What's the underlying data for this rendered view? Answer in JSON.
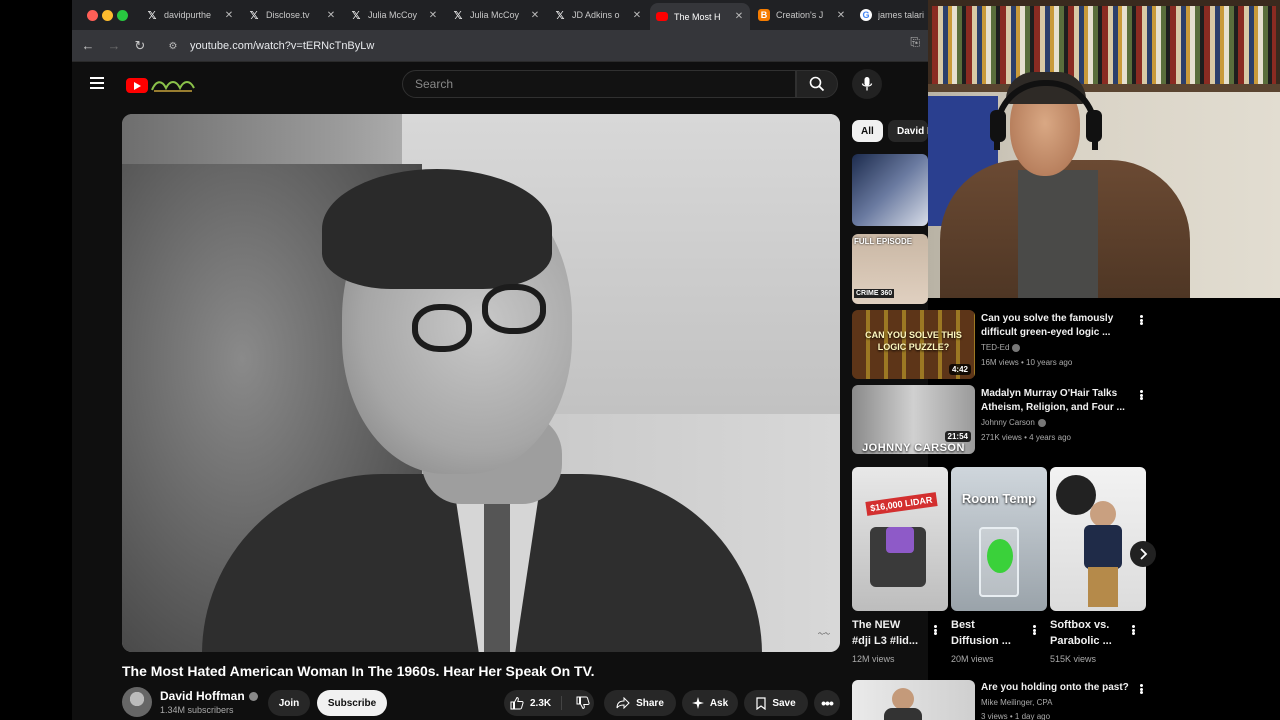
{
  "browser": {
    "tabs": [
      {
        "label": "davidpurthe",
        "icon": "x-icon",
        "active": false
      },
      {
        "label": "Disclose.tv",
        "icon": "x-icon",
        "active": false
      },
      {
        "label": "Julia McCoy",
        "icon": "x-icon",
        "active": false
      },
      {
        "label": "Julia McCoy",
        "icon": "x-icon",
        "active": false
      },
      {
        "label": "JD Adkins o",
        "icon": "x-icon",
        "active": false
      },
      {
        "label": "The Most H",
        "icon": "youtube-icon",
        "active": true
      },
      {
        "label": "Creation's J",
        "icon": "blogger-icon",
        "active": false
      },
      {
        "label": "james talari",
        "icon": "google-icon",
        "active": false
      }
    ],
    "url": "youtube.com/watch?v=tERNcTnByLw"
  },
  "header": {
    "search_placeholder": "Search"
  },
  "video": {
    "title": "The Most Hated American Woman In The 1960s. Hear Her Speak On TV.",
    "channel": "David Hoffman",
    "subscribers": "1.34M subscribers",
    "join_label": "Join",
    "subscribe_label": "Subscribe",
    "likes": "2.3K",
    "share_label": "Share",
    "ask_label": "Ask",
    "save_label": "Save"
  },
  "sidebar": {
    "chips": [
      "All",
      "David H"
    ],
    "videos": [
      {
        "title_line1": "Can you solve the famously",
        "title_line2": "difficult green-eyed logic ...",
        "channel": "TED-Ed",
        "meta": "16M views • 10 years ago",
        "duration": "4:42",
        "thumb_text_1": "CAN YOU SOLVE THIS",
        "thumb_text_2": "LOGIC PUZZLE?"
      },
      {
        "title_line1": "Madalyn Murray O'Hair Talks",
        "title_line2": "Atheism, Religion, and Four ...",
        "channel": "Johnny Carson",
        "meta": "271K views • 4 years ago",
        "duration": "21:54",
        "thumb_text_1": "JOHNNY CARSON"
      },
      {
        "title_line1": "Are you holding onto the past?",
        "title_line2": "",
        "channel": "Mike Meilinger, CPA",
        "meta": "3 views • 1 day ago"
      }
    ],
    "partial_thumbs": {
      "full_episode": "FULL EPISODE",
      "crime_badge": "CRIME 360"
    },
    "shorts": [
      {
        "title_line1": "The NEW",
        "title_line2": "#dji L3 #lid...",
        "views": "12M views",
        "thumb_text": "$16,000 LIDAR"
      },
      {
        "title_line1": "Best",
        "title_line2": "Diffusion ...",
        "views": "20M views",
        "thumb_text": "Room Temp"
      },
      {
        "title_line1": "Softbox vs.",
        "title_line2": "Parabolic ...",
        "views": "515K views"
      }
    ]
  }
}
